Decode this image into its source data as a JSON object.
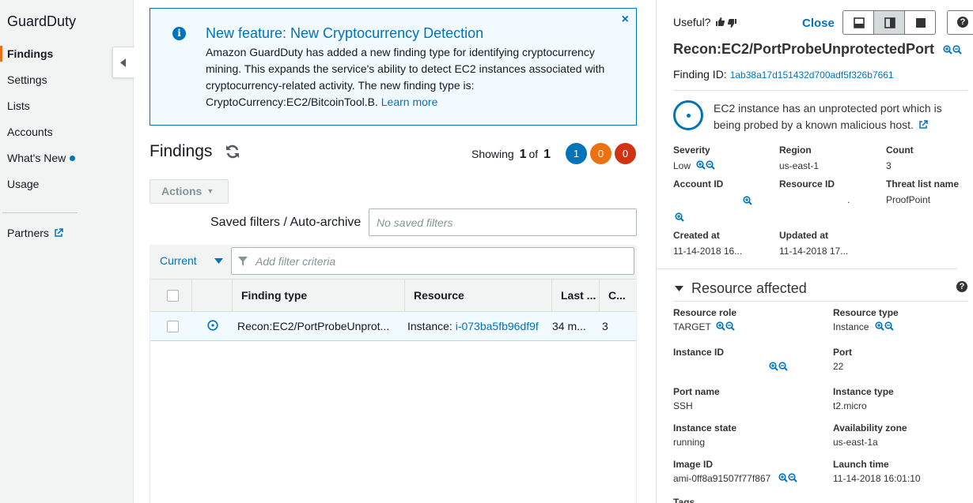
{
  "sidebar": {
    "brand": "GuardDuty",
    "items": [
      {
        "label": "Findings"
      },
      {
        "label": "Settings"
      },
      {
        "label": "Lists"
      },
      {
        "label": "Accounts"
      },
      {
        "label": "What's New"
      },
      {
        "label": "Usage"
      }
    ],
    "partners": "Partners"
  },
  "banner": {
    "title": "New feature: New Cryptocurrency Detection",
    "body": "Amazon GuardDuty has added a new finding type for identifying cryptocurrency mining. This expands the service's ability to detect EC2 instances associated with cryptocurrency-related activity. The new finding type is: CryptoCurrency:EC2/BitcoinTool.B.",
    "link": "Learn more",
    "close": "×"
  },
  "findings": {
    "title": "Findings",
    "showing_label": "Showing",
    "showing_current": "1",
    "showing_of": "of",
    "showing_total": "1",
    "counts": [
      {
        "value": "1",
        "color": "#0073bb"
      },
      {
        "value": "0",
        "color": "#ec7211"
      },
      {
        "value": "0",
        "color": "#d13212"
      }
    ],
    "actions": "Actions",
    "saved_filters_label": "Saved filters / Auto-archive",
    "saved_filters_placeholder": "No saved filters",
    "current": "Current",
    "filter_placeholder": "Add filter criteria"
  },
  "table": {
    "columns": [
      "Finding type",
      "Resource",
      "Last ...",
      "C..."
    ],
    "rows": [
      {
        "finding_type": "Recon:EC2/PortProbeUnprot...",
        "resource_prefix": "Instance: ",
        "resource_link": "i-073ba5fb96df9f",
        "last": "34 m...",
        "count": "3"
      }
    ]
  },
  "panel": {
    "useful": "Useful?",
    "close": "Close",
    "help": "?",
    "title": "Recon:EC2/PortProbeUnprotectedPort",
    "finding_id_label": "Finding ID:",
    "finding_id": "1ab38a17d151432d700adf5f326b7661",
    "description": "EC2 instance has an unprotected port which is being probed by a known malicious host.",
    "severity_label": "Severity",
    "severity": "Low",
    "region_label": "Region",
    "region": "us-east-1",
    "count_label": "Count",
    "count": "3",
    "account_label": "Account ID",
    "resource_id_label": "Resource ID",
    "resource_id": ".",
    "threat_label": "Threat list name",
    "threat": "ProofPoint",
    "created_label": "Created at",
    "created": "11-14-2018 16...",
    "updated_label": "Updated at",
    "updated": "11-14-2018 17...",
    "resource_affected": "Resource affected",
    "role_label": "Resource role",
    "role": "TARGET",
    "type_label": "Resource type",
    "type": "Instance",
    "instance_id_label": "Instance ID",
    "port_label": "Port",
    "port": "22",
    "port_name_label": "Port name",
    "port_name": "SSH",
    "instance_type_label": "Instance type",
    "instance_type": "t2.micro",
    "state_label": "Instance state",
    "state": "running",
    "az_label": "Availability zone",
    "az": "us-east-1a",
    "image_label": "Image ID",
    "image": "ami-0ff8a91507f77f867",
    "launch_label": "Launch time",
    "launch": "11-14-2018 16:01:10",
    "tags_label": "Tags"
  }
}
